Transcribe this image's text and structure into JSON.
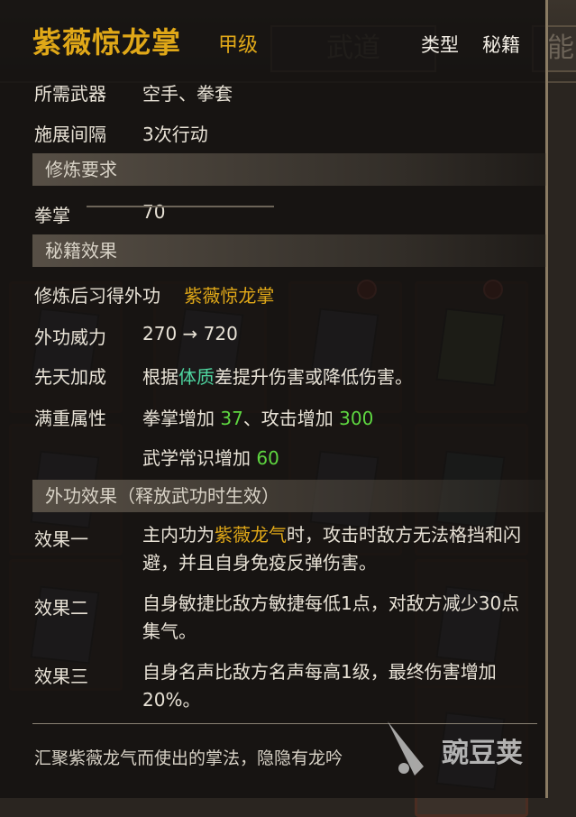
{
  "background": {
    "tabs": [
      "武道",
      "能"
    ]
  },
  "tooltip": {
    "title": "紫薇惊龙掌",
    "grade": "甲级",
    "type_label": "类型",
    "type_value": "秘籍",
    "required_weapon_label": "所需武器",
    "required_weapon_value": "空手、拳套",
    "cast_interval_label": "施展间隔",
    "cast_interval_value": "3次行动",
    "requirements_header": "修炼要求",
    "requirement_skill": "拳掌",
    "requirement_value": "70",
    "effects_header": "秘籍效果",
    "learn_label": "修炼后习得外功",
    "learn_value": "紫薇惊龙掌",
    "power_label": "外功威力",
    "power_value": "270 → 720",
    "innate_label": "先天加成",
    "innate_pre": "根据",
    "innate_attr": "体质",
    "innate_post": "差提升伤害或降低伤害。",
    "max_label": "满重属性",
    "max_line1_a": "拳掌增加 ",
    "max_line1_a_val": "37",
    "max_line1_b": "、攻击增加 ",
    "max_line1_b_val": "300",
    "max_line2_a": "武学常识增加 ",
    "max_line2_a_val": "60",
    "external_header": "外功效果（释放武功时生效）",
    "effect1_label": "效果一",
    "effect1_pre": "主内功为",
    "effect1_highlight": "紫薇龙气",
    "effect1_post": "时，攻击时敌方无法格挡和闪避，并且自身免疫反弹伤害。",
    "effect2_label": "效果二",
    "effect2_text": "自身敏捷比敌方敏捷每低1点，对敌方减少30点集气。",
    "effect3_label": "效果三",
    "effect3_text": "自身名声比敌方名声每高1级，最终伤害增加20%。",
    "description": "汇聚紫薇龙气而使出的掌法，隐隐有龙吟"
  },
  "watermark": {
    "text": "豌豆荚"
  }
}
